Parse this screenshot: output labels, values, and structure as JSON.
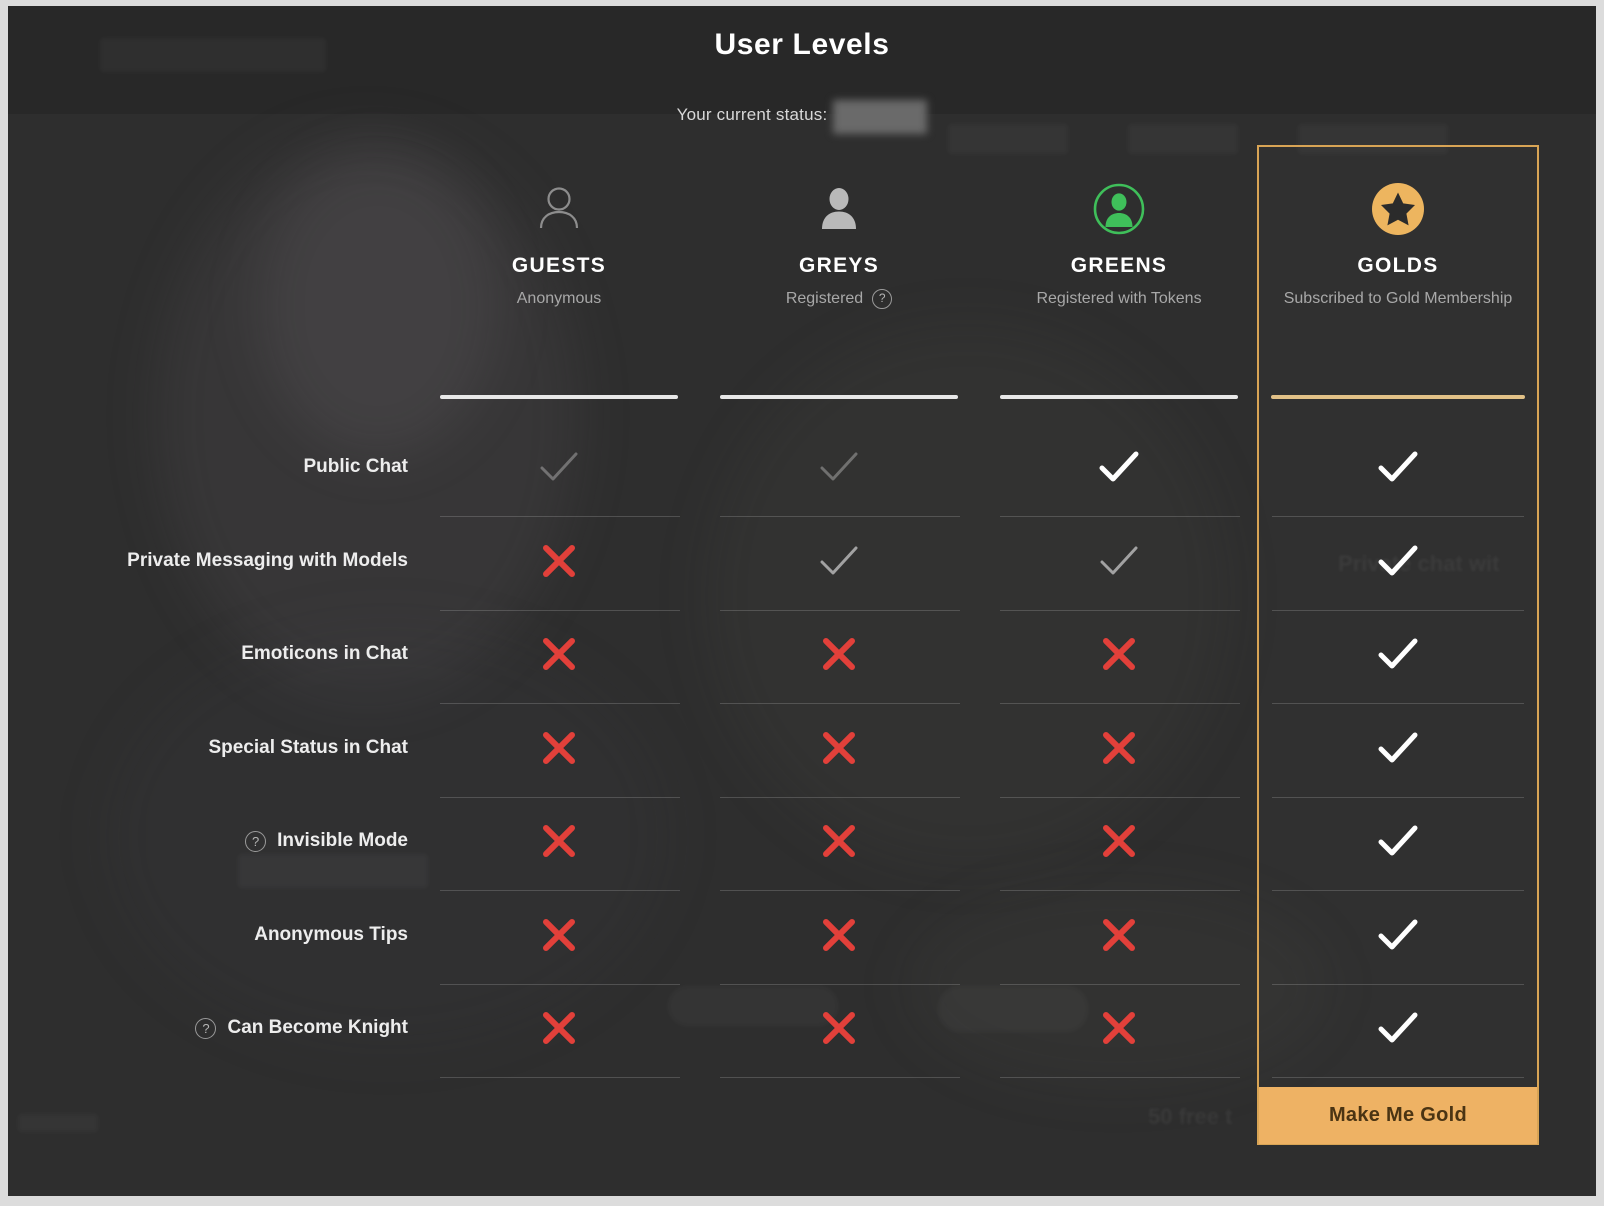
{
  "modal": {
    "title": "User Levels",
    "status_label": "Your current status:",
    "status_value": ""
  },
  "columns": [
    {
      "id": "guests",
      "name": "GUESTS",
      "subtitle": "Anonymous",
      "icon": "user-outline-icon",
      "has_help": false,
      "highlighted": false
    },
    {
      "id": "greys",
      "name": "GREYS",
      "subtitle": "Registered",
      "icon": "user-filled-grey-icon",
      "has_help": true,
      "help_glyph": "?",
      "highlighted": false
    },
    {
      "id": "greens",
      "name": "GREENS",
      "subtitle": "Registered with Tokens",
      "icon": "user-circle-green-icon",
      "has_help": false,
      "highlighted": false
    },
    {
      "id": "golds",
      "name": "GOLDS",
      "subtitle": "Subscribed to Gold Membership",
      "icon": "star-circle-gold-icon",
      "has_help": false,
      "highlighted": true
    }
  ],
  "rows": [
    {
      "label": "Public Chat",
      "has_help": false,
      "values": [
        "check-dim",
        "check-dim",
        "check-full",
        "check-full"
      ]
    },
    {
      "label": "Private Messaging with Models",
      "has_help": false,
      "values": [
        "cross",
        "check-mid",
        "check-mid",
        "check-full"
      ]
    },
    {
      "label": "Emoticons in Chat",
      "has_help": false,
      "values": [
        "cross",
        "cross",
        "cross",
        "check-full"
      ]
    },
    {
      "label": "Special Status in Chat",
      "has_help": false,
      "values": [
        "cross",
        "cross",
        "cross",
        "check-full"
      ]
    },
    {
      "label": "Invisible Mode",
      "has_help": true,
      "help_glyph": "?",
      "values": [
        "cross",
        "cross",
        "cross",
        "check-full"
      ]
    },
    {
      "label": "Anonymous Tips",
      "has_help": false,
      "values": [
        "cross",
        "cross",
        "cross",
        "check-full"
      ]
    },
    {
      "label": "Can Become Knight",
      "has_help": true,
      "help_glyph": "?",
      "values": [
        "cross",
        "cross",
        "cross",
        "check-full"
      ]
    }
  ],
  "cta": {
    "label": "Make Me Gold"
  },
  "colors": {
    "gold": "#eeb264",
    "gold_border": "#d8a455",
    "green": "#3fbf5a",
    "cross_red": "#e2403a",
    "panel_bg": "#2e2e2e",
    "cta_text": "#4a3413"
  }
}
